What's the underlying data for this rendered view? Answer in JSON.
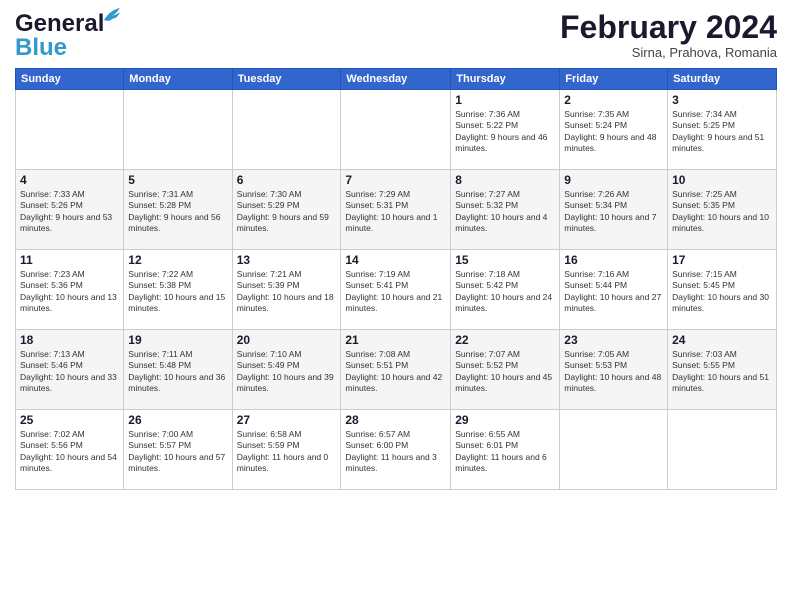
{
  "header": {
    "logo_general": "General",
    "logo_blue": "Blue",
    "month_title": "February 2024",
    "location": "Sirna, Prahova, Romania"
  },
  "calendar": {
    "days_of_week": [
      "Sunday",
      "Monday",
      "Tuesday",
      "Wednesday",
      "Thursday",
      "Friday",
      "Saturday"
    ],
    "weeks": [
      [
        {
          "day": "",
          "info": ""
        },
        {
          "day": "",
          "info": ""
        },
        {
          "day": "",
          "info": ""
        },
        {
          "day": "",
          "info": ""
        },
        {
          "day": "1",
          "info": "Sunrise: 7:36 AM\nSunset: 5:22 PM\nDaylight: 9 hours and 46 minutes."
        },
        {
          "day": "2",
          "info": "Sunrise: 7:35 AM\nSunset: 5:24 PM\nDaylight: 9 hours and 48 minutes."
        },
        {
          "day": "3",
          "info": "Sunrise: 7:34 AM\nSunset: 5:25 PM\nDaylight: 9 hours and 51 minutes."
        }
      ],
      [
        {
          "day": "4",
          "info": "Sunrise: 7:33 AM\nSunset: 5:26 PM\nDaylight: 9 hours and 53 minutes."
        },
        {
          "day": "5",
          "info": "Sunrise: 7:31 AM\nSunset: 5:28 PM\nDaylight: 9 hours and 56 minutes."
        },
        {
          "day": "6",
          "info": "Sunrise: 7:30 AM\nSunset: 5:29 PM\nDaylight: 9 hours and 59 minutes."
        },
        {
          "day": "7",
          "info": "Sunrise: 7:29 AM\nSunset: 5:31 PM\nDaylight: 10 hours and 1 minute."
        },
        {
          "day": "8",
          "info": "Sunrise: 7:27 AM\nSunset: 5:32 PM\nDaylight: 10 hours and 4 minutes."
        },
        {
          "day": "9",
          "info": "Sunrise: 7:26 AM\nSunset: 5:34 PM\nDaylight: 10 hours and 7 minutes."
        },
        {
          "day": "10",
          "info": "Sunrise: 7:25 AM\nSunset: 5:35 PM\nDaylight: 10 hours and 10 minutes."
        }
      ],
      [
        {
          "day": "11",
          "info": "Sunrise: 7:23 AM\nSunset: 5:36 PM\nDaylight: 10 hours and 13 minutes."
        },
        {
          "day": "12",
          "info": "Sunrise: 7:22 AM\nSunset: 5:38 PM\nDaylight: 10 hours and 15 minutes."
        },
        {
          "day": "13",
          "info": "Sunrise: 7:21 AM\nSunset: 5:39 PM\nDaylight: 10 hours and 18 minutes."
        },
        {
          "day": "14",
          "info": "Sunrise: 7:19 AM\nSunset: 5:41 PM\nDaylight: 10 hours and 21 minutes."
        },
        {
          "day": "15",
          "info": "Sunrise: 7:18 AM\nSunset: 5:42 PM\nDaylight: 10 hours and 24 minutes."
        },
        {
          "day": "16",
          "info": "Sunrise: 7:16 AM\nSunset: 5:44 PM\nDaylight: 10 hours and 27 minutes."
        },
        {
          "day": "17",
          "info": "Sunrise: 7:15 AM\nSunset: 5:45 PM\nDaylight: 10 hours and 30 minutes."
        }
      ],
      [
        {
          "day": "18",
          "info": "Sunrise: 7:13 AM\nSunset: 5:46 PM\nDaylight: 10 hours and 33 minutes."
        },
        {
          "day": "19",
          "info": "Sunrise: 7:11 AM\nSunset: 5:48 PM\nDaylight: 10 hours and 36 minutes."
        },
        {
          "day": "20",
          "info": "Sunrise: 7:10 AM\nSunset: 5:49 PM\nDaylight: 10 hours and 39 minutes."
        },
        {
          "day": "21",
          "info": "Sunrise: 7:08 AM\nSunset: 5:51 PM\nDaylight: 10 hours and 42 minutes."
        },
        {
          "day": "22",
          "info": "Sunrise: 7:07 AM\nSunset: 5:52 PM\nDaylight: 10 hours and 45 minutes."
        },
        {
          "day": "23",
          "info": "Sunrise: 7:05 AM\nSunset: 5:53 PM\nDaylight: 10 hours and 48 minutes."
        },
        {
          "day": "24",
          "info": "Sunrise: 7:03 AM\nSunset: 5:55 PM\nDaylight: 10 hours and 51 minutes."
        }
      ],
      [
        {
          "day": "25",
          "info": "Sunrise: 7:02 AM\nSunset: 5:56 PM\nDaylight: 10 hours and 54 minutes."
        },
        {
          "day": "26",
          "info": "Sunrise: 7:00 AM\nSunset: 5:57 PM\nDaylight: 10 hours and 57 minutes."
        },
        {
          "day": "27",
          "info": "Sunrise: 6:58 AM\nSunset: 5:59 PM\nDaylight: 11 hours and 0 minutes."
        },
        {
          "day": "28",
          "info": "Sunrise: 6:57 AM\nSunset: 6:00 PM\nDaylight: 11 hours and 3 minutes."
        },
        {
          "day": "29",
          "info": "Sunrise: 6:55 AM\nSunset: 6:01 PM\nDaylight: 11 hours and 6 minutes."
        },
        {
          "day": "",
          "info": ""
        },
        {
          "day": "",
          "info": ""
        }
      ]
    ]
  }
}
